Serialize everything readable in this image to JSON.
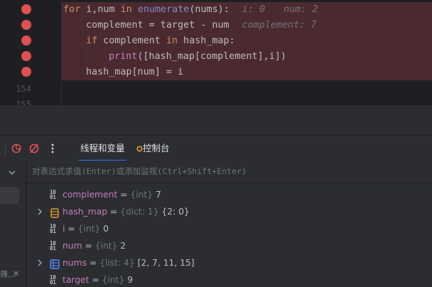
{
  "editor": {
    "line_numbers": [
      "154",
      "155"
    ],
    "code": {
      "l1": {
        "kw_for": "for",
        "vars": " i,num ",
        "kw_in": "in",
        "fn": "enumerate",
        "args": "(nums):",
        "hint_i": "i: 0",
        "hint_num": "num: 2"
      },
      "l2": {
        "text": "complement = target - num",
        "hint": "complement: 7"
      },
      "l3": {
        "kw_if": "if",
        "rest": " complement ",
        "kw_in": "in",
        "rest2": " hash_map:"
      },
      "l4": {
        "fn": "print",
        "args": "([hash_map[complement],i])"
      },
      "l5": {
        "text": "hash_map[num] = i"
      }
    }
  },
  "toolbar": {
    "tabs": [
      {
        "label": "线程和变量"
      },
      {
        "label": "控制台"
      }
    ],
    "icons": [
      "view-breakpoints-icon",
      "mute-breakpoints-icon",
      "more-options-icon"
    ]
  },
  "left_panel": {
    "frame_label_truncated": "筛..."
  },
  "eval": {
    "placeholder": "对表达式求值(Enter)或添加监视(Ctrl+Shift+Enter)"
  },
  "variables": [
    {
      "name": "complement",
      "type": "{int}",
      "value": "7",
      "expandable": false,
      "icon": "primitive-icon"
    },
    {
      "name": "hash_map",
      "type": "{dict: 1}",
      "value": "{2: 0}",
      "expandable": true,
      "icon": "dict-icon"
    },
    {
      "name": "i",
      "type": "{int}",
      "value": "0",
      "expandable": false,
      "icon": "primitive-icon"
    },
    {
      "name": "num",
      "type": "{int}",
      "value": "2",
      "expandable": false,
      "icon": "primitive-icon"
    },
    {
      "name": "nums",
      "type": "{list: 4}",
      "value": "[2, 7, 11, 15]",
      "expandable": true,
      "icon": "list-icon"
    },
    {
      "name": "target",
      "type": "{int}",
      "value": "9",
      "expandable": false,
      "icon": "primitive-icon"
    }
  ],
  "colors": {
    "breakpoint": "#e05050",
    "breakpoint_line_bg": "#4b2a2f",
    "active_tab_underline": "#3574f0"
  }
}
